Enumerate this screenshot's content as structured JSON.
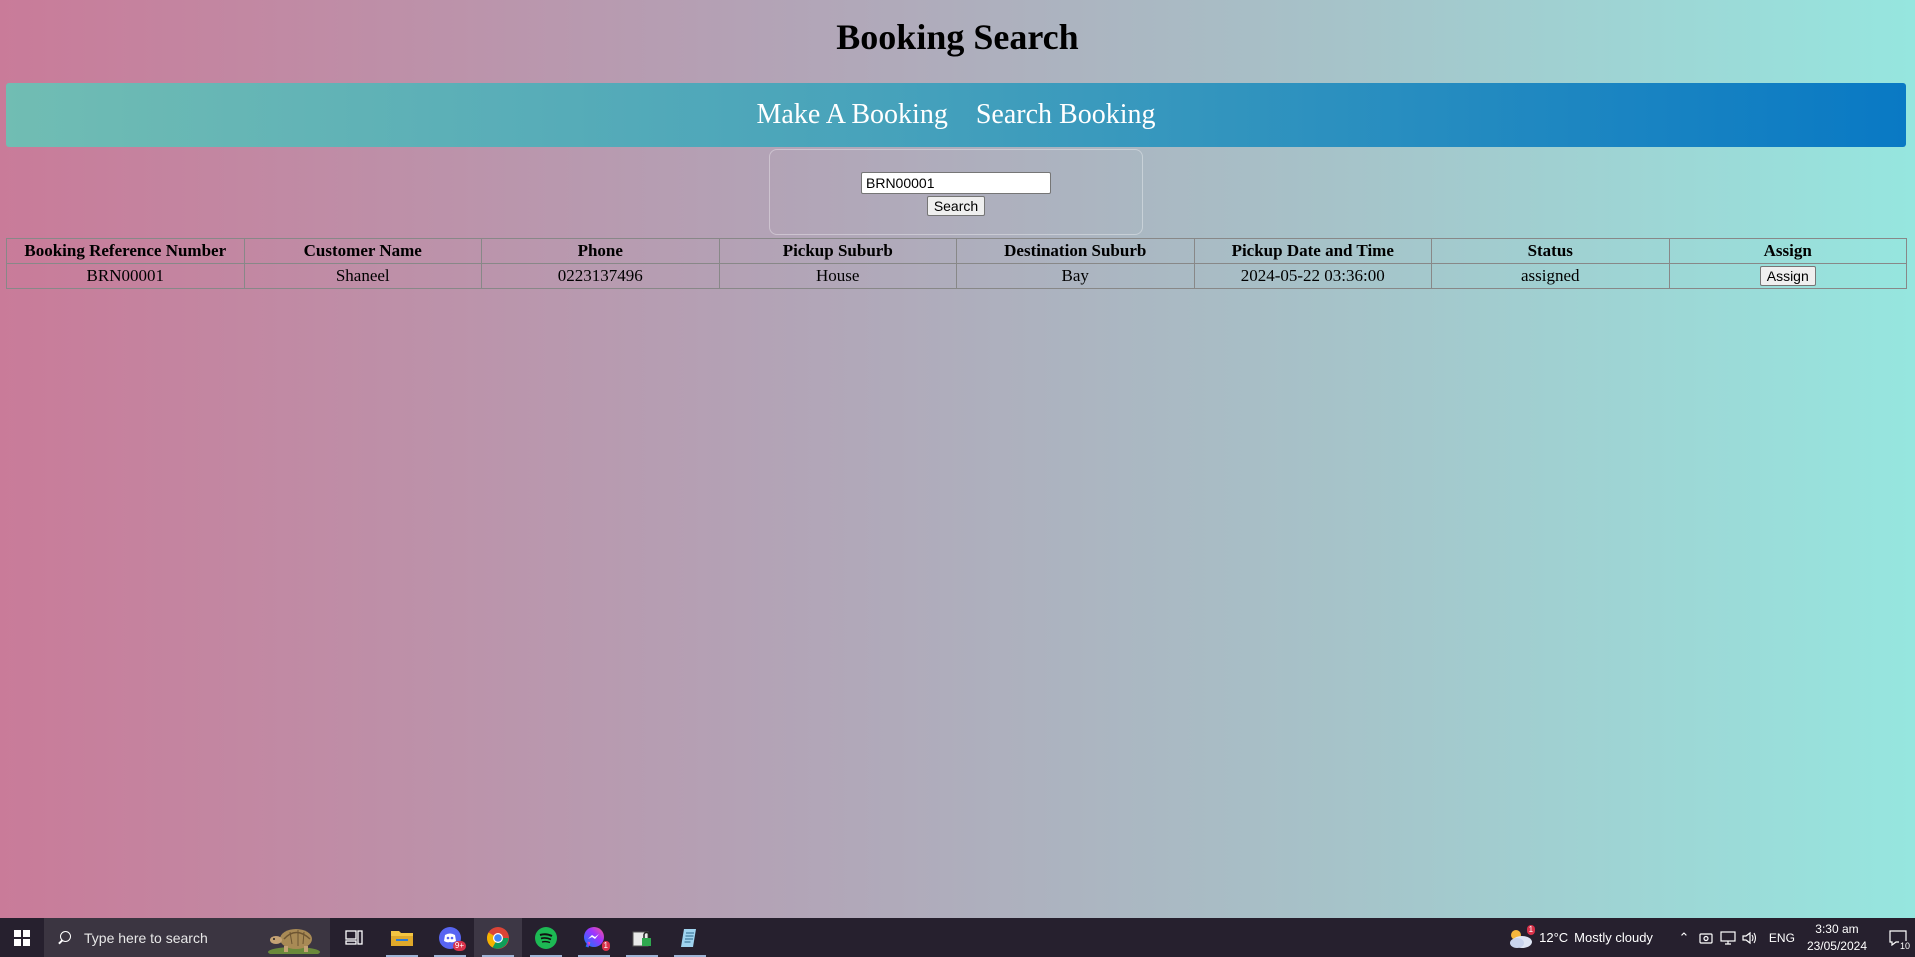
{
  "page": {
    "title": "Booking Search"
  },
  "nav": {
    "items": [
      {
        "label": "Make A Booking"
      },
      {
        "label": "Search Booking"
      }
    ]
  },
  "search": {
    "value": "BRN00001",
    "button_label": "Search"
  },
  "table": {
    "headers": [
      "Booking Reference Number",
      "Customer Name",
      "Phone",
      "Pickup Suburb",
      "Destination Suburb",
      "Pickup Date and Time",
      "Status",
      "Assign"
    ],
    "rows": [
      {
        "reference": "BRN00001",
        "customer": "Shaneel",
        "phone": "0223137496",
        "pickup_suburb": "House",
        "destination_suburb": "Bay",
        "pickup_datetime": "2024-05-22 03:36:00",
        "status": "assigned",
        "assign_label": "Assign"
      }
    ]
  },
  "taskbar": {
    "search_placeholder": "Type here to search",
    "icons": [
      "task-view-icon",
      "file-explorer-icon",
      "discord-icon",
      "chrome-icon",
      "spotify-icon",
      "messenger-icon",
      "secure-folder-icon",
      "notepad-icon"
    ],
    "discord_badge": "9+",
    "messenger_badge": "1",
    "weather_badge": "1",
    "weather_temp": "12°C",
    "weather_desc": "Mostly cloudy",
    "language": "ENG",
    "time": "3:30 am",
    "date": "23/05/2024",
    "notification_count": "10"
  },
  "colors": {
    "nav_start": "#71bdb3",
    "nav_end": "#0979c4",
    "bg_left": "#c97b99",
    "bg_right": "#96e6df",
    "taskbar": "#26202e"
  }
}
